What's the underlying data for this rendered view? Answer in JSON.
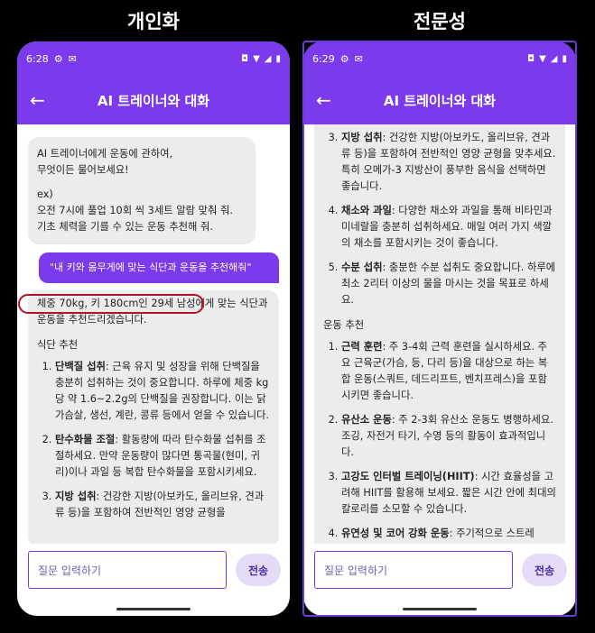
{
  "panels": {
    "left_label": "개인화",
    "right_label": "전문성"
  },
  "left_phone": {
    "status_time": "6:28",
    "title": "AI 트레이너와 대화",
    "greeting": [
      "AI 트레이너에게 운동에 관하여,",
      "무엇이든 물어보세요!",
      "",
      "ex)",
      "오전 7시에 풀업 10회 씩 3세트 알람 맞춰 줘.",
      "기초 체력을 기를 수 있는 운동 추천해 줘."
    ],
    "user_message": "\"내 키와 몸무게에 맞는 식단과 운동을 추천해줘\"",
    "response_intro": "체중 70kg, 키 180cm인 29세 남성에게 맞는 식단과 운동을 추천드리겠습니다.",
    "diet_section": "식단 추천",
    "diet_items": [
      {
        "title": "단백질 섭취",
        "text": ": 근육 유지 및 성장을 위해 단백질을 충분히 섭취하는 것이 중요합니다. 하루에 체중 kg당 약 1.6~2.2g의 단백질을 권장합니다. 이는 닭가슴살, 생선, 계란, 콩류 등에서 얻을 수 있습니다."
      },
      {
        "title": "탄수화물 조절",
        "text": ": 활동량에 따라 탄수화물 섭취를 조절하세요. 만약 운동량이 많다면 통곡물(현미, 귀리)이나 과일 등 복합 탄수화물을 포함시키세요."
      },
      {
        "title": "지방 섭취",
        "text": ": 건강한 지방(아보카도, 올리브유, 견과류 등)을 포함하여 전반적인 영양 균형을"
      }
    ],
    "input_placeholder": "질문 입력하기",
    "send_label": "전송"
  },
  "right_phone": {
    "status_time": "6:29",
    "title": "AI 트레이너와 대화",
    "diet_items": [
      {
        "title": "지방 섭취",
        "text": ": 건강한 지방(아보카도, 올리브유, 견과류 등)을 포함하여 전반적인 영양 균형을 맞추세요. 특히 오메가-3 지방산이 풍부한 음식을 선택하면 좋습니다."
      },
      {
        "title": "채소와 과일",
        "text": ": 다양한 채소와 과일을 통해 비타민과 미네랄을 충분히 섭취하세요. 매일 여러 가지 색깔의 채소를 포함시키는 것이 좋습니다."
      },
      {
        "title": "수분 섭취",
        "text": ": 충분한 수분 섭취도 중요합니다. 하루에 최소 2리터 이상의 물을 마시는 것을 목표로 하세요."
      }
    ],
    "exercise_section": "운동 추천",
    "exercise_items": [
      {
        "title": "근력 훈련",
        "text": ": 주 3-4회 근력 훈련을 실시하세요. 주요 근육군(가슴, 등, 다리 등)을 대상으로 하는 복합 운동(스쿼트, 데드리프트, 벤치프레스)을 포함시키면 좋습니다."
      },
      {
        "title": "유산소 운동",
        "text": ": 주 2-3회 유산소 운동도 병행하세요. 조깅, 자전거 타기, 수영 등의 활동이 효과적입니다."
      },
      {
        "title": "고강도 인터벌 트레이닝(HIIT)",
        "text": ": 시간 효율성을 고려해 HIIT를 활용해 보세요. 짧은 시간 안에 최대의 칼로리를 소모할 수 있습니다."
      },
      {
        "title": "유연성 및 코어 강화 운동",
        "text": ": 주기적으로 스트레"
      }
    ],
    "input_placeholder": "질문 입력하기",
    "send_label": "전송"
  },
  "icons": {
    "settings": "gear-icon",
    "gmail": "mail-icon",
    "vibrate": "vibrate-icon",
    "wifi": "wifi-icon",
    "signal": "signal-icon",
    "battery": "battery-icon",
    "back": "back-arrow-icon"
  },
  "colors": {
    "accent": "#7c3aed",
    "highlight": "#b31229"
  }
}
